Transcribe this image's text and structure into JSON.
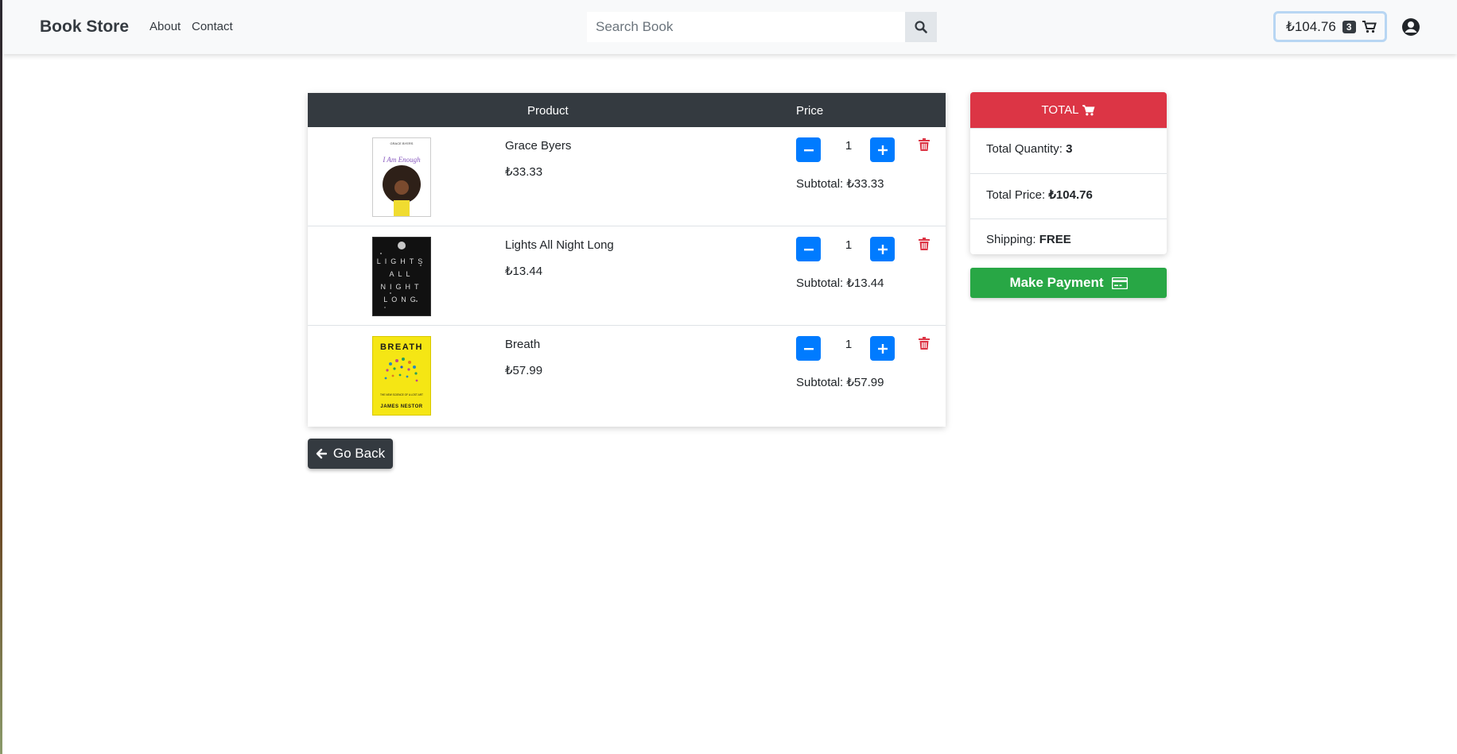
{
  "navbar": {
    "brand": "Book Store",
    "links": [
      "About",
      "Contact"
    ],
    "search_placeholder": "Search Book",
    "cart_total": "₺104.76",
    "cart_count": "3"
  },
  "table": {
    "headers": [
      "Product",
      "Price"
    ],
    "items": [
      {
        "name": "Grace Byers",
        "price": "₺33.33",
        "qty": "1",
        "subtotal": "Subtotal: ₺33.33",
        "cover_top": "GRACE BYERS",
        "cover_title": "I Am Enough"
      },
      {
        "name": "Lights All Night Long",
        "price": "₺13.44",
        "qty": "1",
        "subtotal": "Subtotal: ₺13.44",
        "cover_title": "LIGHTS ALL NIGHT LONG"
      },
      {
        "name": "Breath",
        "price": "₺57.99",
        "qty": "1",
        "subtotal": "Subtotal: ₺57.99",
        "cover_title": "BREATH",
        "cover_sub": "THE NEW SCIENCE OF A LOST ART",
        "cover_author": "JAMES NESTOR"
      }
    ]
  },
  "go_back": "Go Back",
  "summary": {
    "header": "TOTAL",
    "quantity_label": "Total Quantity:",
    "quantity_value": "3",
    "price_label": "Total Price:",
    "price_value": "₺104.76",
    "shipping_label": "Shipping:",
    "shipping_value": "FREE"
  },
  "make_payment": "Make Payment",
  "colors": {
    "navbar_bg": "#f8f9fa",
    "table_header": "#343a40",
    "quantity_button": "#007bff",
    "delete_icon": "#dc3545",
    "total_header": "#dc3545",
    "payment_button": "#28a745"
  }
}
